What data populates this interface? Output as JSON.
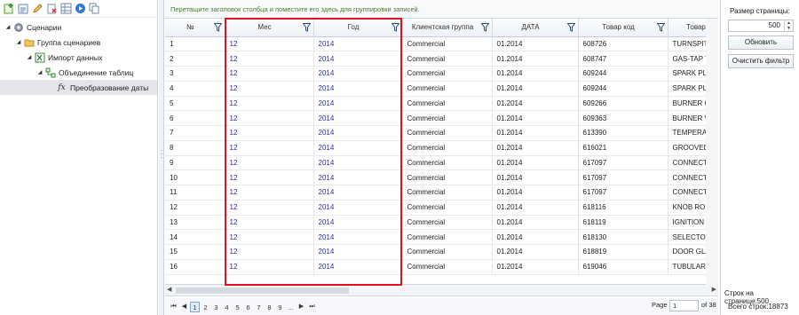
{
  "tree": {
    "items": [
      {
        "label": "Сценарии",
        "level": 0,
        "icon": "gear-icon"
      },
      {
        "label": "Группа сценариев",
        "level": 1,
        "icon": "folder-icon"
      },
      {
        "label": "Импорт данных",
        "level": 2,
        "icon": "excel-import-icon"
      },
      {
        "label": "Объединение таблиц",
        "level": 3,
        "icon": "merge-tables-icon"
      },
      {
        "label": "Преобразование даты",
        "level": 4,
        "icon": "function-fx-icon",
        "selected": true
      }
    ]
  },
  "grid": {
    "group_hint": "Перетащите заголовок столбца и поместите его здесь для группировки записей.",
    "columns": [
      "№",
      "Мес",
      "Год",
      "Клиентская группа",
      "ДАТА",
      "Товар код",
      "Товар"
    ],
    "rows": [
      [
        "1",
        "12",
        "2014",
        "Commercial",
        "01.2014",
        "608726",
        "TURNSPIT"
      ],
      [
        "2",
        "12",
        "2014",
        "Commercial",
        "01.2014",
        "608747",
        "GAS-TAP T"
      ],
      [
        "3",
        "12",
        "2014",
        "Commercial",
        "01.2014",
        "609244",
        "SPARK PLU"
      ],
      [
        "4",
        "12",
        "2014",
        "Commercial",
        "01.2014",
        "609244",
        "SPARK PLU"
      ],
      [
        "5",
        "12",
        "2014",
        "Commercial",
        "01.2014",
        "609266",
        "BURNER C"
      ],
      [
        "6",
        "12",
        "2014",
        "Commercial",
        "01.2014",
        "609363",
        "BURNER V"
      ],
      [
        "7",
        "12",
        "2014",
        "Commercial",
        "01.2014",
        "613390",
        "TEMPERAT"
      ],
      [
        "8",
        "12",
        "2014",
        "Commercial",
        "01.2014",
        "616021",
        "GROOVED"
      ],
      [
        "9",
        "12",
        "2014",
        "Commercial",
        "01.2014",
        "617097",
        "CONNECTI"
      ],
      [
        "10",
        "12",
        "2014",
        "Commercial",
        "01.2014",
        "617097",
        "CONNECTI"
      ],
      [
        "11",
        "12",
        "2014",
        "Commercial",
        "01.2014",
        "617097",
        "CONNECTI"
      ],
      [
        "12",
        "12",
        "2014",
        "Commercial",
        "01.2014",
        "618116",
        "KNOB ROS"
      ],
      [
        "13",
        "12",
        "2014",
        "Commercial",
        "01.2014",
        "618119",
        "IGNITION I"
      ],
      [
        "14",
        "12",
        "2014",
        "Commercial",
        "01.2014",
        "618130",
        "SELECTOR"
      ],
      [
        "15",
        "12",
        "2014",
        "Commercial",
        "01.2014",
        "618819",
        "DOOR GLA"
      ],
      [
        "16",
        "12",
        "2014",
        "Commercial",
        "01.2014",
        "619046",
        "TUBULAR I"
      ]
    ]
  },
  "pager": {
    "first": "⏮",
    "prev": "◀",
    "next": "▶",
    "last": "⏭",
    "pages": [
      "1",
      "2",
      "3",
      "4",
      "5",
      "6",
      "7",
      "8",
      "9",
      "..."
    ],
    "current_page": "1",
    "page_label": "Page",
    "page_value": "1",
    "of_label": "of 38"
  },
  "right_panel": {
    "page_size_label": "Размер страницы:",
    "page_size_value": "500",
    "refresh_button": "Обновить",
    "clear_filter_button": "Очистить фильтр",
    "rows_per_page": "Строк на странице:500",
    "total_rows": "Всего строк:18873"
  },
  "colors": {
    "highlight_box": "#e0121b",
    "link_numbers": "#2b2bb0",
    "group_hint": "#4d7a2a"
  }
}
